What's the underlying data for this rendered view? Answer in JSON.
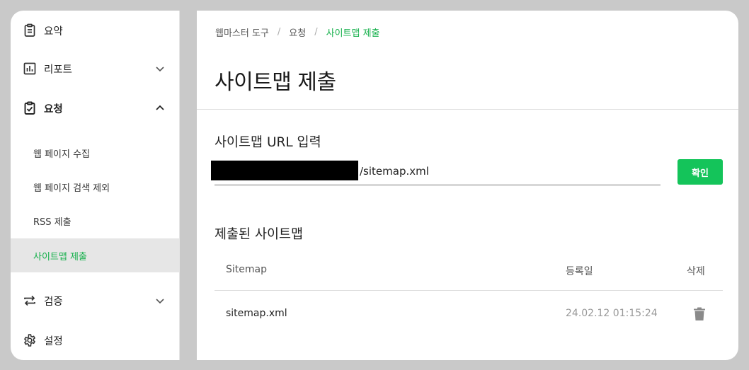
{
  "sidebar": {
    "items": [
      {
        "label": "요약",
        "icon": "clipboard-icon"
      },
      {
        "label": "리포트",
        "icon": "bar-chart-icon",
        "chevron": "chevron-down-icon"
      },
      {
        "label": "요청",
        "icon": "clipboard-check-icon",
        "chevron": "chevron-up-icon"
      },
      {
        "label": "검증",
        "icon": "repeat-arrows-icon",
        "chevron": "chevron-down-icon"
      },
      {
        "label": "설정",
        "icon": "gear-icon"
      }
    ],
    "sub_items": [
      {
        "label": "웹 페이지 수집"
      },
      {
        "label": "웹 페이지 검색 제외"
      },
      {
        "label": "RSS 제출"
      },
      {
        "label": "사이트맵 제출"
      }
    ]
  },
  "breadcrumb": {
    "items": [
      "웹마스터 도구",
      "요청",
      "사이트맵 제출"
    ],
    "separator": "/"
  },
  "page_title": "사이트맵 제출",
  "url_section": {
    "title": "사이트맵 URL 입력",
    "input_value": "/sitemap.xml",
    "confirm_label": "확인"
  },
  "submitted_section": {
    "title": "제출된 사이트맵",
    "columns": [
      "Sitemap",
      "등록일",
      "삭제"
    ],
    "rows": [
      {
        "sitemap": "sitemap.xml",
        "date": "24.02.12 01:15:24"
      }
    ]
  },
  "colors": {
    "accent": "#15b04b",
    "button": "#14c45a",
    "selected_bg": "#e6e6e6",
    "frame": "#c9c9c9"
  }
}
